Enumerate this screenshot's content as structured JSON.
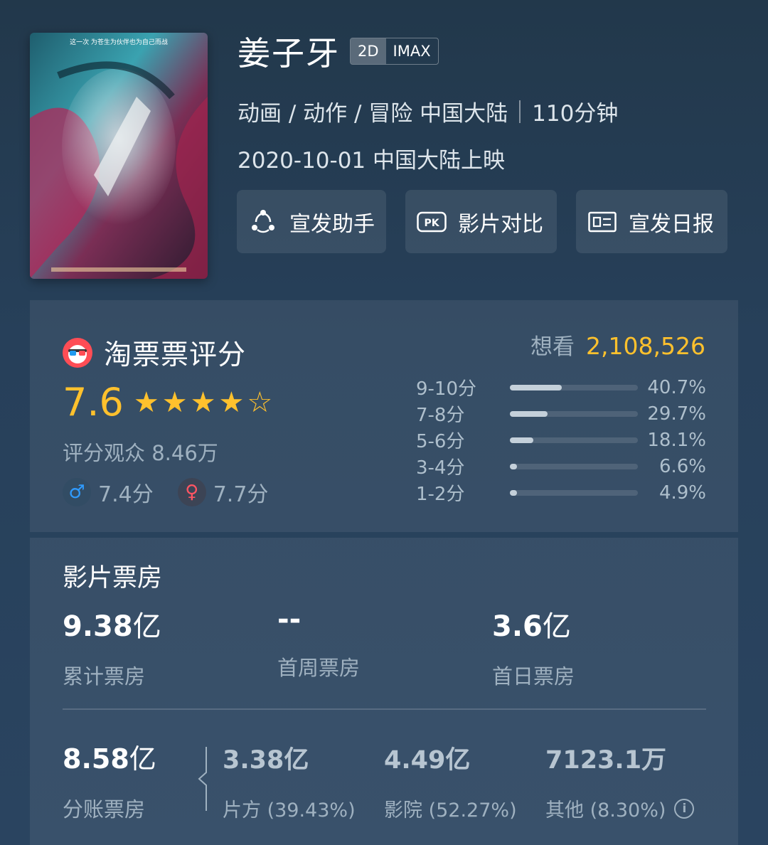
{
  "movie": {
    "poster_text": "这一次 为苍生为伙伴也为自己而战",
    "title": "姜子牙",
    "formats": [
      "2D",
      "IMAX"
    ],
    "genres": "动画 / 动作 / 冒险 中国大陆",
    "duration": "110分钟",
    "release": "2020-10-01 中国大陆上映"
  },
  "actions": [
    {
      "label": "宣发助手",
      "icon": "share-network-icon"
    },
    {
      "label": "影片对比",
      "icon": "pk-icon"
    },
    {
      "label": "宣发日报",
      "icon": "report-card-icon"
    }
  ],
  "rating": {
    "brand": "淘票票评分",
    "score": "7.6",
    "stars_full": 4,
    "stars_half": 1,
    "raters": "评分观众 8.46万",
    "male": "7.4分",
    "female": "7.7分",
    "want_label": "想看",
    "want_count": "2,108,526",
    "distribution": [
      {
        "label": "9-10分",
        "pct": "40.7%",
        "value": 40.7
      },
      {
        "label": "7-8分",
        "pct": "29.7%",
        "value": 29.7
      },
      {
        "label": "5-6分",
        "pct": "18.1%",
        "value": 18.1
      },
      {
        "label": "3-4分",
        "pct": "6.6%",
        "value": 6.6
      },
      {
        "label": "1-2分",
        "pct": "4.9%",
        "value": 4.9
      }
    ]
  },
  "box_office": {
    "title": "影片票房",
    "total": {
      "value": "9.38",
      "unit": "亿",
      "label": "累计票房"
    },
    "first_week": {
      "value": "--",
      "label": "首周票房"
    },
    "first_day": {
      "value": "3.6",
      "unit": "亿",
      "label": "首日票房"
    },
    "split": {
      "value": "8.58",
      "unit": "亿",
      "label": "分账票房"
    },
    "producer": {
      "value": "3.38亿",
      "label": "片方 (39.43%)"
    },
    "cinema": {
      "value": "4.49亿",
      "label": "影院 (52.27%)"
    },
    "other": {
      "value": "7123.1万",
      "label": "其他 (8.30%)"
    }
  },
  "colors": {
    "accent": "#ffc12d",
    "background": "#22384b",
    "male": "#2f9bff",
    "female": "#ff5563"
  }
}
